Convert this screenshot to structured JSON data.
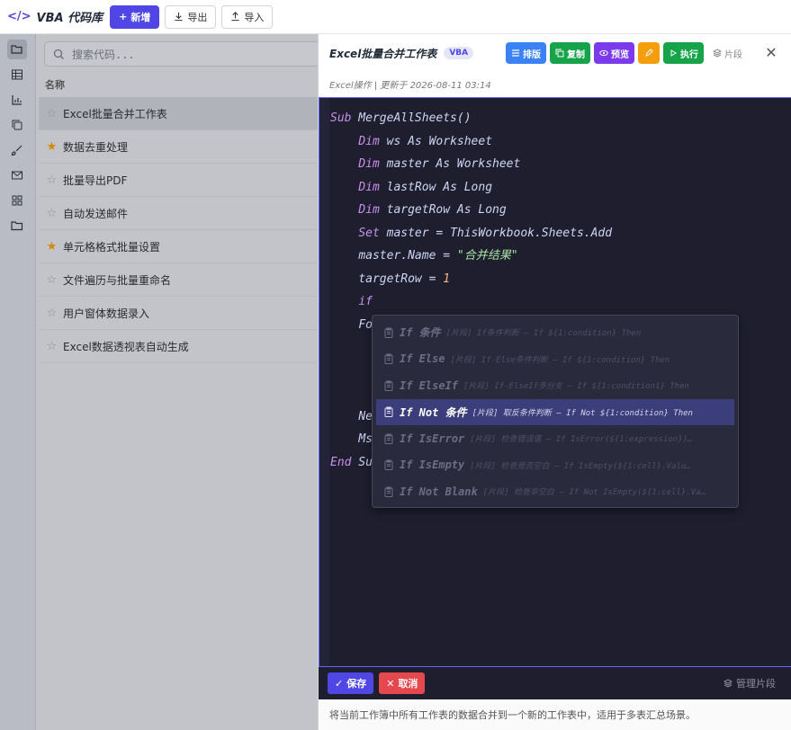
{
  "app": {
    "title": "VBA 代码库",
    "new_label": "新增",
    "export_label": "导出",
    "import_label": "导入"
  },
  "search": {
    "placeholder": "搜索代码..."
  },
  "list": {
    "header": "名称",
    "items": [
      {
        "name": "Excel批量合并工作表",
        "starred": false,
        "selected": true
      },
      {
        "name": "数据去重处理",
        "starred": true,
        "selected": false
      },
      {
        "name": "批量导出PDF",
        "starred": false,
        "selected": false
      },
      {
        "name": "自动发送邮件",
        "starred": false,
        "selected": false
      },
      {
        "name": "单元格格式批量设置",
        "starred": true,
        "selected": false
      },
      {
        "name": "文件遍历与批量重命名",
        "starred": false,
        "selected": false
      },
      {
        "name": "用户窗体数据录入",
        "starred": false,
        "selected": false
      },
      {
        "name": "Excel数据透视表自动生成",
        "starred": false,
        "selected": false
      }
    ]
  },
  "detail": {
    "title": "Excel批量合并工作表",
    "language": "VBA",
    "meta": "Excel操作 | 更新于 2026-08-11 03:14",
    "actions": {
      "format": "排版",
      "copy": "复制",
      "preview": "预览",
      "run": "执行",
      "snippets": "片段"
    },
    "code": {
      "l1_kw": "Sub",
      "l1_rest": " MergeAllSheets()",
      "l2_kw": "Dim",
      "l2_rest": " ws As Worksheet",
      "l3_kw": "Dim",
      "l3_rest": " master As Worksheet",
      "l4_kw": "Dim",
      "l4_rest": " lastRow As Long",
      "l5_kw": "Dim",
      "l5_rest": " targetRow As Long",
      "l6_kw": "Set",
      "l6_rest": " master = ThisWorkbook.Sheets.Add",
      "l7_pre": "master.Name = ",
      "l7_str": "\"合并结果\"",
      "l8_pre": "targetRow = ",
      "l8_num": "1",
      "l9": "if",
      "l10": "Fo",
      "l11": "Ne",
      "l12": "Ms",
      "l13_kw": "End",
      "l13_rest": " Sub"
    },
    "suggestions": [
      {
        "name": "If 条件",
        "desc": "[片段] If条件判断 — If ${1:condition} Then",
        "active": false
      },
      {
        "name": "If Else",
        "desc": "[片段] If-Else条件判断 — If ${1:condition} Then",
        "active": false
      },
      {
        "name": "If ElseIf",
        "desc": "[片段] If-ElseIf多分支 — If ${1:condition1} Then",
        "active": false
      },
      {
        "name": "If Not 条件",
        "desc": "[片段] 取反条件判断 — If Not ${1:condition} Then",
        "active": true
      },
      {
        "name": "If IsError",
        "desc": "[片段] 检查错误值 — If IsError(${1:expression})…",
        "active": false
      },
      {
        "name": "If IsEmpty",
        "desc": "[片段] 检查是否空白 — If IsEmpty(${1:cell}.Valu…",
        "active": false
      },
      {
        "name": "If Not Blank",
        "desc": "[片段] 检查非空白 — If Not IsEmpty(${1:cell}.Va…",
        "active": false
      }
    ],
    "save_label": "保存",
    "cancel_label": "取消",
    "manage_label": "管理片段",
    "description": "将当前工作簿中所有工作表的数据合并到一个新的工作表中，适用于多表汇总场景。"
  }
}
